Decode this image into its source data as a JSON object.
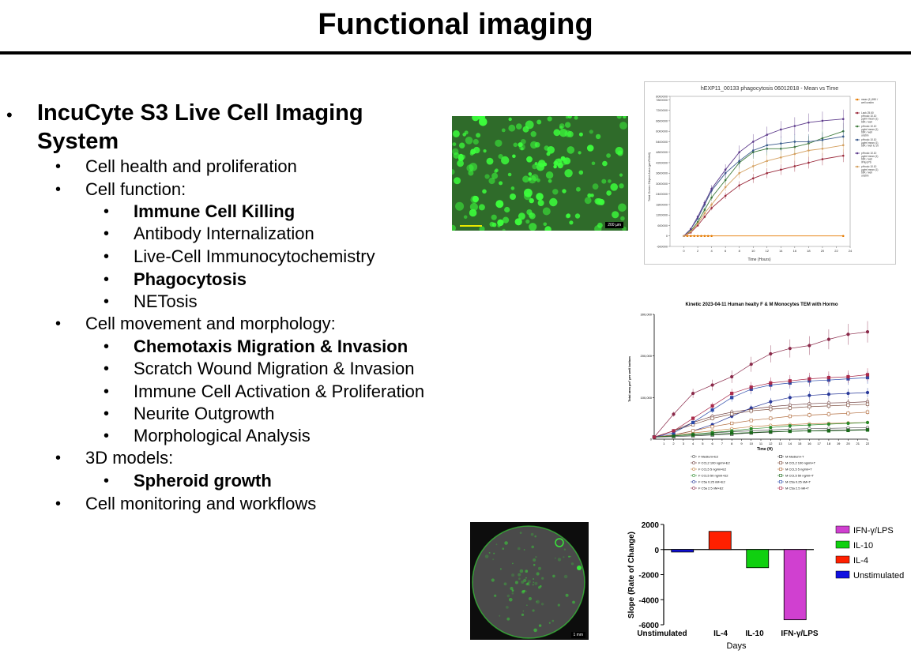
{
  "title": "Functional imaging",
  "bullets": {
    "main": "IncuCyte S3 Live Cell Imaging",
    "main_cont": "System",
    "items": [
      {
        "text": "Cell health and proliferation",
        "level": 2
      },
      {
        "text": "Cell function:",
        "level": 2
      },
      {
        "text": "Immune Cell Killing",
        "level": 3,
        "bold": true
      },
      {
        "text": "Antibody Internalization",
        "level": 3
      },
      {
        "text": "Live-Cell Immunocytochemistry",
        "level": 3
      },
      {
        "text": "Phagocytosis",
        "level": 3,
        "bold": true
      },
      {
        "text": "NETosis",
        "level": 3
      },
      {
        "text": "Cell movement and morphology:",
        "level": 2
      },
      {
        "text": "Chemotaxis Migration & Invasion",
        "level": 3,
        "bold": true
      },
      {
        "text": "Scratch Wound Migration & Invasion",
        "level": 3
      },
      {
        "text": "Immune Cell Activation & Proliferation",
        "level": 3
      },
      {
        "text": "Neurite Outgrowth",
        "level": 3
      },
      {
        "text": "Morphological Analysis",
        "level": 3
      },
      {
        "text": "3D models:",
        "level": 2
      },
      {
        "text": "Spheroid growth",
        "level": 3,
        "bold": true
      },
      {
        "text": "Cell monitoring and workflows",
        "level": 2
      }
    ]
  },
  "images": {
    "cell_image_top": {
      "scale_label": "200 µm",
      "fill": "#2f6b2a",
      "accent": "#3cff3c"
    },
    "spheroid_image": {
      "scale_label": "1 mm",
      "fill": "#0d0d0d",
      "accent": "#39e639"
    }
  },
  "chart_data": [
    {
      "type": "line",
      "title": "hEXP11_00133 phagocytosis 06012018 - Mean vs Time",
      "xlabel": "Time (Hours)",
      "ylabel": "Total Green Object Area (µm²/Well)",
      "xlim": [
        -2,
        24
      ],
      "ylim": [
        -600000,
        8000000
      ],
      "x_ticks": [
        0,
        2,
        4,
        6,
        8,
        10,
        12,
        14,
        16,
        18,
        20,
        22,
        24
      ],
      "y_ticks": [
        -600000,
        0,
        600000,
        1200000,
        1800000,
        2400000,
        3000000,
        3600000,
        4200000,
        4800000,
        5400000,
        6000000,
        6600000,
        7200000,
        7800000,
        8000000
      ],
      "legend_position": "right",
      "series": [
        {
          "name": "mean (1) 69K / well unstim",
          "color": "#e57a00",
          "x": [
            0,
            0.5,
            1,
            1.5,
            2,
            2.5,
            3,
            3.5,
            4,
            23
          ],
          "y": [
            0,
            0,
            0,
            0,
            0,
            0,
            0,
            0,
            0,
            0
          ]
        },
        {
          "name": "Lack 25.60 pHrodo 10.10 µg/ml mean (1) 69K / well unstim",
          "color": "#9b2a3c",
          "x": [
            0,
            1,
            2,
            3,
            4,
            6,
            8,
            10,
            12,
            14,
            16,
            18,
            20,
            23
          ],
          "y": [
            0,
            200000,
            600000,
            1100000,
            1600000,
            2300000,
            2900000,
            3300000,
            3600000,
            3800000,
            4000000,
            4200000,
            4400000,
            4600000
          ]
        },
        {
          "name": "pHrodo 10.10 µg/ml mean (1) 69K / well unstim",
          "color": "#3c7a3a",
          "x": [
            0,
            1,
            2,
            3,
            4,
            6,
            8,
            10,
            12,
            14,
            16,
            18,
            20,
            23
          ],
          "y": [
            0,
            300000,
            800000,
            1500000,
            2200000,
            3200000,
            4200000,
            4800000,
            5000000,
            5000000,
            5100000,
            5300000,
            5600000,
            6000000
          ]
        },
        {
          "name": "pHrodo 10.10 µg/ml mean (1) 69K / well IL-10",
          "color": "#3a5a8c",
          "x": [
            0,
            1,
            2,
            3,
            4,
            6,
            8,
            10,
            12,
            14,
            16,
            18,
            20,
            23
          ],
          "y": [
            0,
            400000,
            1000000,
            1800000,
            2600000,
            3600000,
            4300000,
            4900000,
            5200000,
            5300000,
            5400000,
            5400000,
            5500000,
            5700000
          ]
        },
        {
          "name": "pHrodo 10.10 µg/ml mean (1) 69K / well IFNγLPS",
          "color": "#5e3c8c",
          "x": [
            0,
            1,
            2,
            3,
            4,
            6,
            8,
            10,
            12,
            14,
            16,
            18,
            20,
            23
          ],
          "y": [
            0,
            400000,
            1100000,
            1900000,
            2700000,
            3800000,
            4800000,
            5400000,
            5800000,
            6100000,
            6300000,
            6500000,
            6600000,
            6700000
          ]
        },
        {
          "name": "pHrodo 10.10 µg/ml mean (1) 69K / well unstim",
          "color": "#d4a060",
          "x": [
            0,
            1,
            2,
            3,
            4,
            6,
            8,
            10,
            12,
            14,
            16,
            18,
            20,
            23
          ],
          "y": [
            0,
            250000,
            700000,
            1300000,
            1800000,
            2800000,
            3600000,
            4000000,
            4300000,
            4500000,
            4700000,
            4900000,
            5000000,
            5200000
          ]
        }
      ]
    },
    {
      "type": "line",
      "title": "Kinetic 2023-04-11 Human healty F & M Monocytes TEM with Hormo",
      "xlabel": "Time (H)",
      "ylabel": "Total area µm² per well bottom",
      "xlim": [
        0,
        22
      ],
      "ylim": [
        0,
        300000
      ],
      "x_ticks": [
        1,
        2,
        3,
        4,
        5,
        6,
        7,
        8,
        9,
        10,
        11,
        12,
        13,
        14,
        15,
        16,
        17,
        18,
        19,
        20,
        21,
        22
      ],
      "y_ticks": [
        0,
        100000,
        200000,
        300000
      ],
      "y_tick_labels": [
        "0",
        "100,000",
        "200,000",
        "300,000"
      ],
      "legend_position": "bottom",
      "series": [
        {
          "name": "F Medium+E2",
          "color": "#555555",
          "x": [
            0,
            2,
            4,
            6,
            8,
            10,
            12,
            14,
            16,
            18,
            20,
            22
          ],
          "y": [
            5000,
            8000,
            12000,
            15000,
            18000,
            20000,
            22000,
            24000,
            25000,
            26000,
            27000,
            28000
          ]
        },
        {
          "name": "F CCL2 100 ng/ml+E2",
          "color": "#6b3a3a",
          "x": [
            0,
            2,
            4,
            6,
            8,
            10,
            12,
            14,
            16,
            18,
            20,
            22
          ],
          "y": [
            5000,
            20000,
            40000,
            55000,
            65000,
            72000,
            78000,
            82000,
            85000,
            87000,
            88000,
            90000
          ]
        },
        {
          "name": "F CCL5 5 ng/ml+E2",
          "color": "#c08040",
          "x": [
            0,
            2,
            4,
            6,
            8,
            10,
            12,
            14,
            16,
            18,
            20,
            22
          ],
          "y": [
            5000,
            10000,
            15000,
            20000,
            25000,
            30000,
            33000,
            35000,
            37000,
            38000,
            39000,
            40000
          ]
        },
        {
          "name": "F CCL5 50 ng/ml+E2",
          "color": "#2a8a2a",
          "x": [
            0,
            2,
            4,
            6,
            8,
            10,
            12,
            14,
            16,
            18,
            20,
            22
          ],
          "y": [
            5000,
            8000,
            12000,
            16000,
            20000,
            25000,
            28000,
            32000,
            34000,
            36000,
            38000,
            40000
          ]
        },
        {
          "name": "F C5a 0.25 nM+E2",
          "color": "#2a3a9a",
          "x": [
            0,
            2,
            4,
            6,
            8,
            10,
            12,
            14,
            16,
            18,
            20,
            22
          ],
          "y": [
            5000,
            10000,
            20000,
            35000,
            55000,
            75000,
            90000,
            100000,
            105000,
            108000,
            110000,
            112000
          ]
        },
        {
          "name": "F C5a 2.5 nM+E2",
          "color": "#8a2a4a",
          "x": [
            0,
            2,
            4,
            6,
            8,
            10,
            12,
            14,
            16,
            18,
            20,
            22
          ],
          "y": [
            5000,
            60000,
            110000,
            130000,
            150000,
            180000,
            205000,
            218000,
            225000,
            240000,
            252000,
            258000
          ]
        },
        {
          "name": "M Medium+T",
          "color": "#333333",
          "x": [
            0,
            2,
            4,
            6,
            8,
            10,
            12,
            14,
            16,
            18,
            20,
            22
          ],
          "y": [
            5000,
            6000,
            8000,
            10000,
            12000,
            15000,
            17000,
            19000,
            20000,
            21000,
            22000,
            23000
          ]
        },
        {
          "name": "M CCL2 100 ng/ml+T",
          "color": "#7a4a3a",
          "x": [
            0,
            2,
            4,
            6,
            8,
            10,
            12,
            14,
            16,
            18,
            20,
            22
          ],
          "y": [
            5000,
            20000,
            35000,
            50000,
            60000,
            68000,
            72000,
            75000,
            78000,
            80000,
            82000,
            84000
          ]
        },
        {
          "name": "M CCL5 5 ng/ml+T",
          "color": "#b06a3a",
          "x": [
            0,
            2,
            4,
            6,
            8,
            10,
            12,
            14,
            16,
            18,
            20,
            22
          ],
          "y": [
            5000,
            10000,
            20000,
            30000,
            38000,
            45000,
            50000,
            55000,
            58000,
            60000,
            62000,
            65000
          ]
        },
        {
          "name": "M CCL5 50 ng/ml+T",
          "color": "#1a6a1a",
          "x": [
            0,
            2,
            4,
            6,
            8,
            10,
            12,
            14,
            16,
            18,
            20,
            22
          ],
          "y": [
            5000,
            8000,
            10000,
            12000,
            14000,
            16000,
            18000,
            19000,
            20000,
            20000,
            21000,
            22000
          ]
        },
        {
          "name": "M C5a 0.25 nM+T",
          "color": "#2a4aaa",
          "x": [
            0,
            2,
            4,
            6,
            8,
            10,
            12,
            14,
            16,
            18,
            20,
            22
          ],
          "y": [
            5000,
            15000,
            40000,
            70000,
            100000,
            120000,
            130000,
            135000,
            140000,
            142000,
            145000,
            148000
          ]
        },
        {
          "name": "M C5a 2.5 nM+T",
          "color": "#aa2a4a",
          "x": [
            0,
            2,
            4,
            6,
            8,
            10,
            12,
            14,
            16,
            18,
            20,
            22
          ],
          "y": [
            5000,
            20000,
            50000,
            80000,
            110000,
            125000,
            135000,
            140000,
            145000,
            148000,
            150000,
            155000
          ]
        }
      ]
    },
    {
      "type": "bar",
      "title": "",
      "xlabel": "Days",
      "ylabel": "Slope (Rate of Change)",
      "categories": [
        "Unstimulated",
        "IL-4",
        "IL-10",
        "IFN-γ/LPS"
      ],
      "values": [
        -200,
        1450,
        -1450,
        -5600
      ],
      "colors": [
        "#1010e0",
        "#ff2000",
        "#10d010",
        "#d040d0"
      ],
      "ylim": [
        -6000,
        2000
      ],
      "y_ticks": [
        -6000,
        -4000,
        -2000,
        0,
        2000
      ],
      "legend_position": "right",
      "legend": [
        {
          "name": "IFN-γ/LPS",
          "color": "#d040d0"
        },
        {
          "name": "IL-10",
          "color": "#10d010"
        },
        {
          "name": "IL-4",
          "color": "#ff2000"
        },
        {
          "name": "Unstimulated",
          "color": "#1010e0"
        }
      ]
    }
  ]
}
